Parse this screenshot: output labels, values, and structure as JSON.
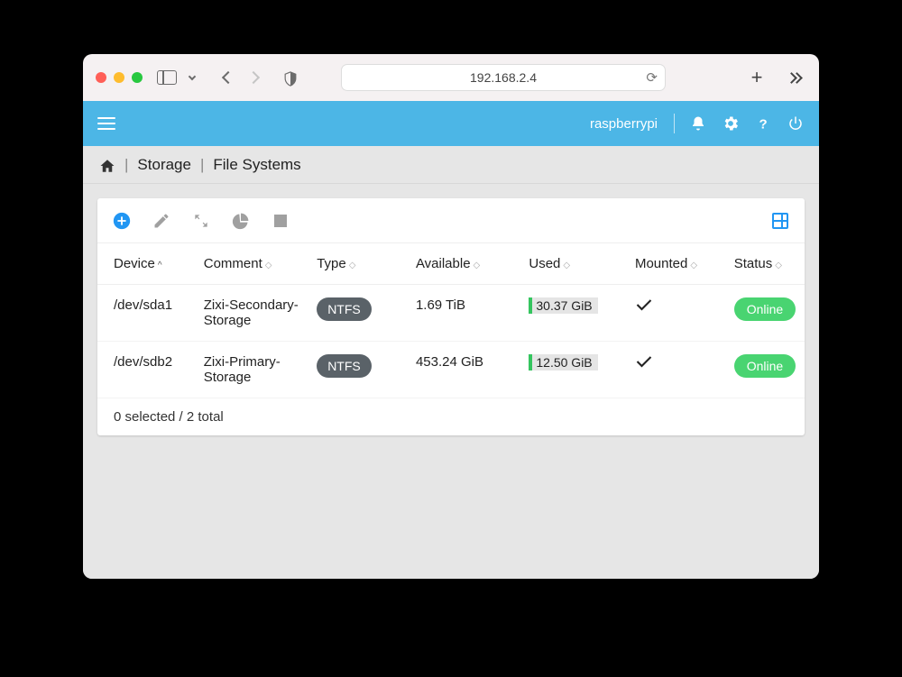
{
  "browser": {
    "address": "192.168.2.4"
  },
  "app": {
    "hostname": "raspberrypi"
  },
  "breadcrumb": {
    "level1": "Storage",
    "level2": "File Systems"
  },
  "columns": {
    "device": "Device",
    "comment": "Comment",
    "type": "Type",
    "available": "Available",
    "used": "Used",
    "mounted": "Mounted",
    "status": "Status"
  },
  "rows": [
    {
      "device": "/dev/sda1",
      "comment": "Zixi-Secondary-Storage",
      "type": "NTFS",
      "available": "1.69 TiB",
      "used": "30.37 GiB",
      "mounted": true,
      "status": "Online"
    },
    {
      "device": "/dev/sdb2",
      "comment": "Zixi-Primary-Storage",
      "type": "NTFS",
      "available": "453.24 GiB",
      "used": "12.50 GiB",
      "mounted": true,
      "status": "Online"
    }
  ],
  "footer": {
    "text": "0 selected / 2 total"
  }
}
